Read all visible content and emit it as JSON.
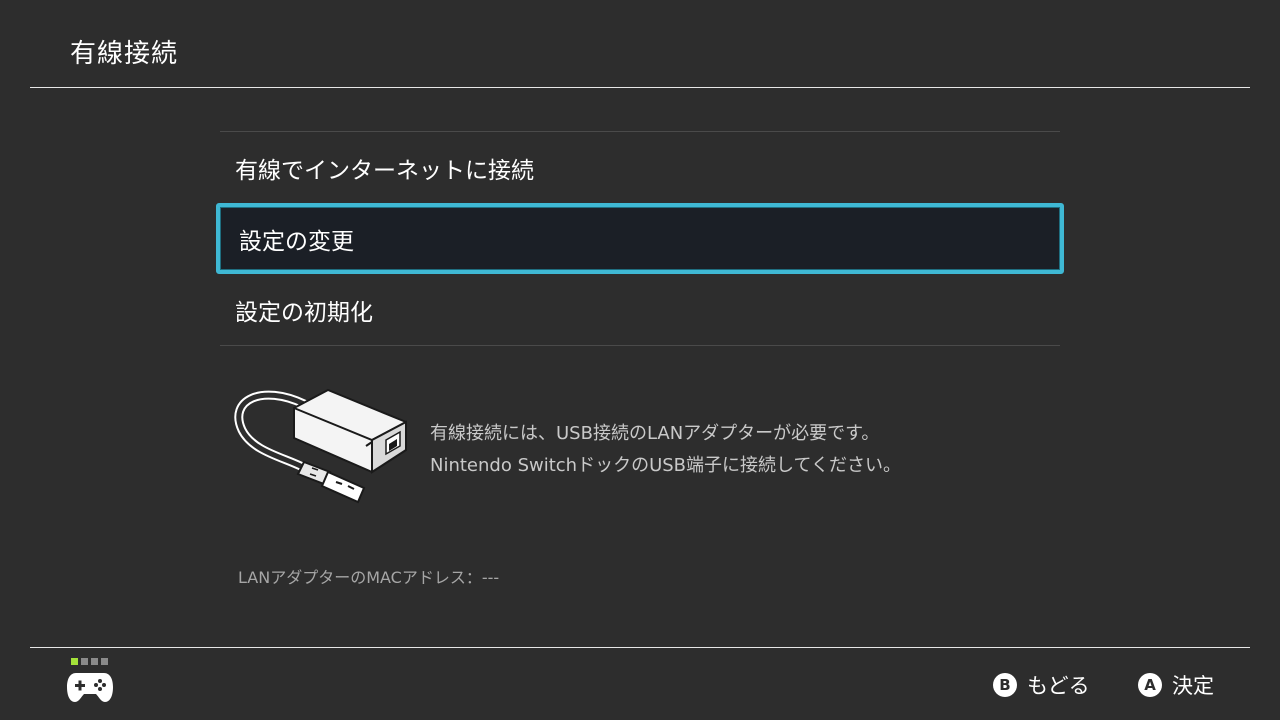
{
  "header": {
    "title": "有線接続"
  },
  "menu": {
    "items": [
      {
        "label": "有線でインターネットに接続",
        "selected": false
      },
      {
        "label": "設定の変更",
        "selected": true
      },
      {
        "label": "設定の初期化",
        "selected": false
      }
    ]
  },
  "info": {
    "illustration": "usb-lan-adapter-icon",
    "line1": "有線接続には、USB接続のLANアダプターが必要です。",
    "line2": "Nintendo SwitchドックのUSB端子に接続してください。"
  },
  "mac": {
    "text": "LANアダプターのMACアドレス：---"
  },
  "footer": {
    "controller_icon": "controller-icon",
    "player_indicator": {
      "active": 1,
      "total": 4
    },
    "back": {
      "glyph": "B",
      "label": "もどる"
    },
    "confirm": {
      "glyph": "A",
      "label": "決定"
    }
  },
  "colors": {
    "background": "#2d2d2d",
    "selection_border": "#3fb8d4",
    "selection_fill": "#1b1f26",
    "player_active": "#a4e23a"
  }
}
